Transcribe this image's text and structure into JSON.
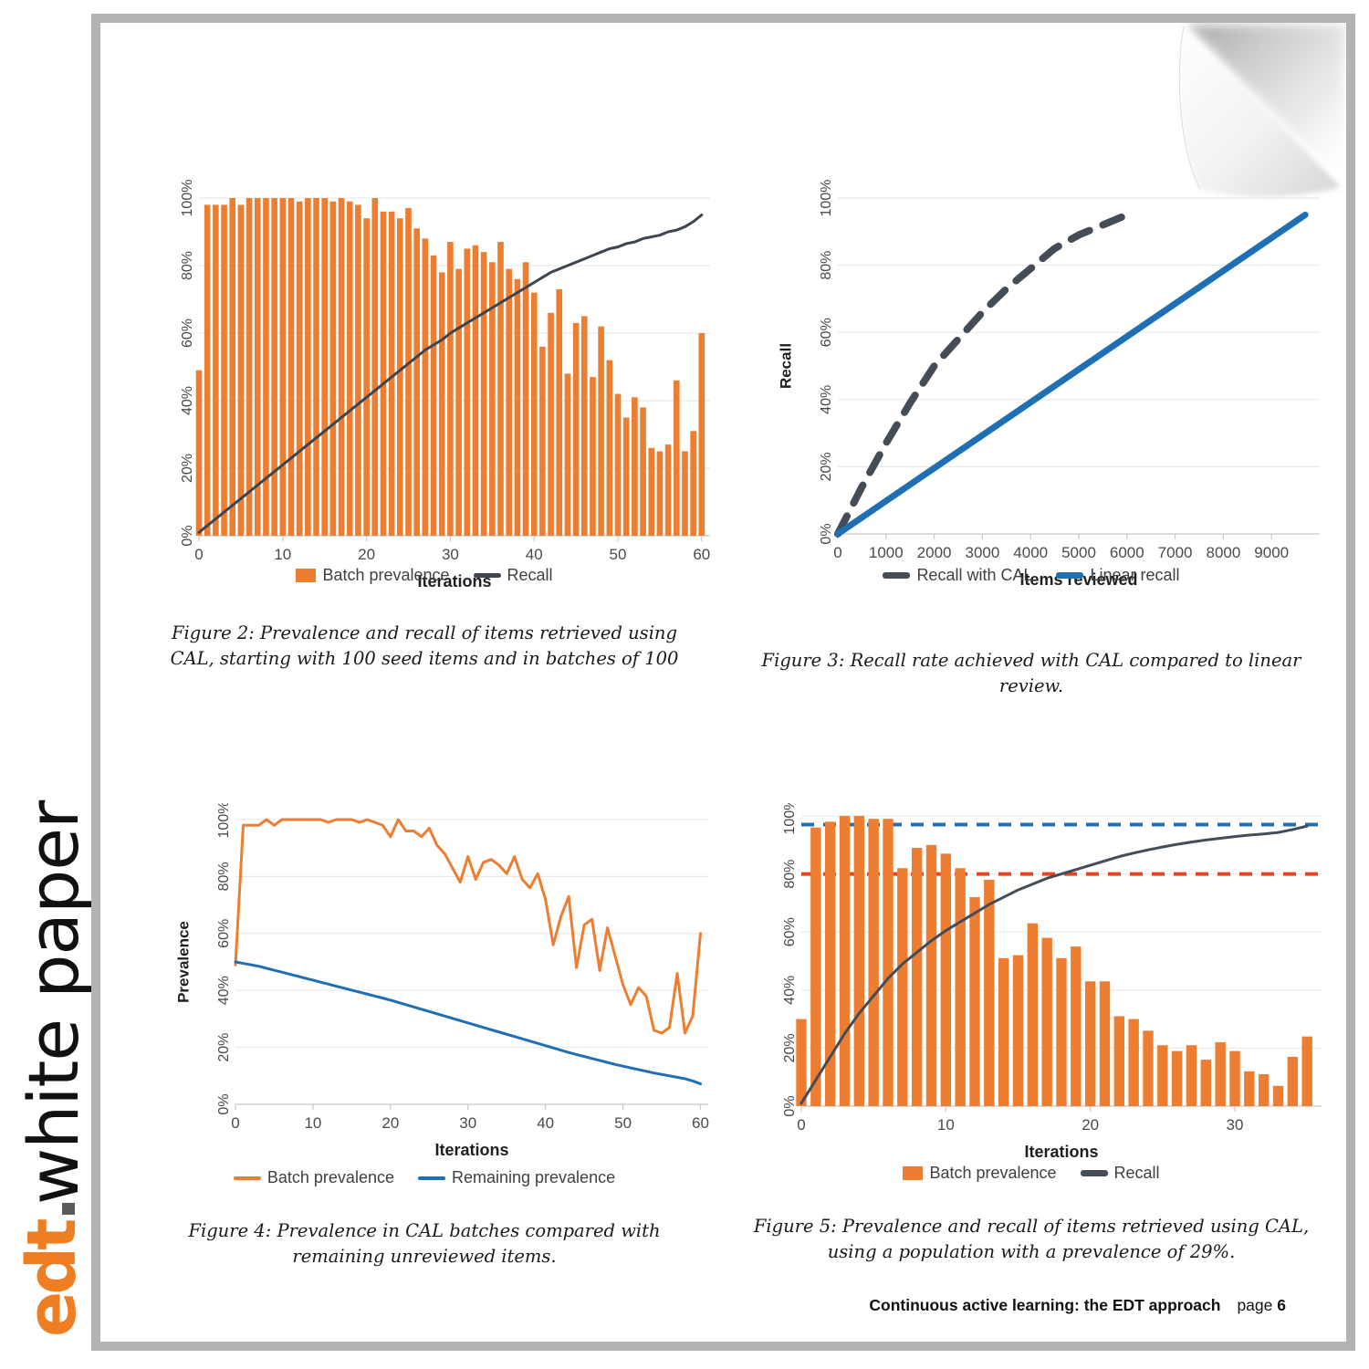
{
  "spine": {
    "logo_text": "edt",
    "logo_dot": ".",
    "label": "white paper"
  },
  "footer": {
    "title": "Continuous active learning: the EDT approach",
    "page_word": "page",
    "page_number": "6"
  },
  "figures": [
    {
      "id": "figure-2",
      "caption": "Figure 2: Prevalence and recall of items retrieved using CAL, starting with 100 seed items and in batches of 100",
      "legend": [
        {
          "label": "Batch prevalence",
          "marker": "box",
          "color": "#ed7d31"
        },
        {
          "label": "Recall",
          "marker": "line",
          "color": "#3c4550"
        }
      ]
    },
    {
      "id": "figure-3",
      "caption": "Figure 3: Recall rate achieved with CAL compared to linear review.",
      "legend": [
        {
          "label": "Recall with CAL",
          "marker": "dashed-line",
          "color": "#444d57"
        },
        {
          "label": "Linear recall",
          "marker": "line",
          "color": "#1f6fb4"
        }
      ]
    },
    {
      "id": "figure-4",
      "caption": "Figure 4: Prevalence in CAL batches compared with remaining unreviewed items.",
      "legend": [
        {
          "label": "Batch prevalence",
          "marker": "line",
          "color": "#ed7d31"
        },
        {
          "label": "Remaining prevalence",
          "marker": "line",
          "color": "#1f6fb4"
        }
      ]
    },
    {
      "id": "figure-5",
      "caption": "Figure 5: Prevalence and recall of items retrieved using CAL, using a population with a prevalence of 29%.",
      "legend": [
        {
          "label": "Batch prevalence",
          "marker": "box",
          "color": "#ed7d31"
        },
        {
          "label": "Recall",
          "marker": "line",
          "color": "#444d57"
        }
      ]
    }
  ],
  "chart_data": [
    {
      "id": "figure-2",
      "type": "bar",
      "title": "",
      "xlabel": "Iterations",
      "ylabel": "",
      "xlim": [
        0,
        61
      ],
      "ylim": [
        0,
        1.0
      ],
      "xticks": [
        0,
        10,
        20,
        30,
        40,
        50,
        60
      ],
      "yticks": [
        "0%",
        "20%",
        "40%",
        "60%",
        "80%",
        "100%"
      ],
      "grid": true,
      "legend_position": "bottom",
      "categories": [
        0,
        1,
        2,
        3,
        4,
        5,
        6,
        7,
        8,
        9,
        10,
        11,
        12,
        13,
        14,
        15,
        16,
        17,
        18,
        19,
        20,
        21,
        22,
        23,
        24,
        25,
        26,
        27,
        28,
        29,
        30,
        31,
        32,
        33,
        34,
        35,
        36,
        37,
        38,
        39,
        40,
        41,
        42,
        43,
        44,
        45,
        46,
        47,
        48,
        49,
        50,
        51,
        52,
        53,
        54,
        55,
        56,
        57,
        58,
        59,
        60
      ],
      "series": [
        {
          "name": "Batch prevalence",
          "type": "bar",
          "color": "#ed7d31",
          "values": [
            0.49,
            0.98,
            0.98,
            0.98,
            1.0,
            0.98,
            1.0,
            1.0,
            1.0,
            1.0,
            1.0,
            1.0,
            0.99,
            1.0,
            1.0,
            1.0,
            0.99,
            1.0,
            0.99,
            0.98,
            0.94,
            1.0,
            0.96,
            0.96,
            0.94,
            0.97,
            0.91,
            0.88,
            0.83,
            0.78,
            0.87,
            0.79,
            0.85,
            0.86,
            0.84,
            0.81,
            0.87,
            0.79,
            0.76,
            0.81,
            0.72,
            0.56,
            0.66,
            0.73,
            0.48,
            0.63,
            0.65,
            0.47,
            0.62,
            0.52,
            0.42,
            0.35,
            0.41,
            0.38,
            0.26,
            0.25,
            0.27,
            0.46,
            0.25,
            0.31,
            0.6
          ]
        },
        {
          "name": "Recall",
          "type": "line",
          "color": "#3c4550",
          "values": [
            0.01,
            0.03,
            0.05,
            0.07,
            0.09,
            0.11,
            0.13,
            0.15,
            0.17,
            0.19,
            0.21,
            0.23,
            0.25,
            0.27,
            0.29,
            0.31,
            0.33,
            0.35,
            0.37,
            0.39,
            0.41,
            0.43,
            0.45,
            0.47,
            0.49,
            0.51,
            0.53,
            0.55,
            0.565,
            0.58,
            0.6,
            0.615,
            0.63,
            0.645,
            0.66,
            0.675,
            0.69,
            0.705,
            0.72,
            0.735,
            0.75,
            0.765,
            0.78,
            0.79,
            0.8,
            0.81,
            0.82,
            0.83,
            0.84,
            0.85,
            0.855,
            0.865,
            0.87,
            0.88,
            0.885,
            0.89,
            0.9,
            0.905,
            0.915,
            0.93,
            0.95
          ]
        }
      ]
    },
    {
      "id": "figure-3",
      "type": "line",
      "title": "",
      "xlabel": "Items reviewed",
      "ylabel": "Recall",
      "xlim": [
        0,
        10000
      ],
      "ylim": [
        0,
        1.0
      ],
      "xticks": [
        0,
        1000,
        2000,
        3000,
        4000,
        5000,
        6000,
        7000,
        8000,
        9000
      ],
      "yticks": [
        "0%",
        "20%",
        "40%",
        "60%",
        "80%",
        "100%"
      ],
      "grid": true,
      "legend_position": "bottom",
      "series": [
        {
          "name": "Recall with CAL",
          "style": "dashed",
          "color": "#444d57",
          "x": [
            0,
            500,
            1000,
            1500,
            2000,
            2500,
            3000,
            3500,
            4000,
            4500,
            5000,
            5500,
            6000
          ],
          "y": [
            0.0,
            0.14,
            0.27,
            0.39,
            0.5,
            0.58,
            0.66,
            0.73,
            0.79,
            0.85,
            0.89,
            0.92,
            0.95
          ]
        },
        {
          "name": "Linear recall",
          "style": "solid",
          "color": "#1f6fb4",
          "x": [
            0,
            9700
          ],
          "y": [
            0.0,
            0.95
          ]
        }
      ]
    },
    {
      "id": "figure-4",
      "type": "line",
      "title": "",
      "xlabel": "Iterations",
      "ylabel": "Prevalence",
      "xlim": [
        0,
        61
      ],
      "ylim": [
        0,
        1.0
      ],
      "xticks": [
        0,
        10,
        20,
        30,
        40,
        50,
        60
      ],
      "yticks": [
        "0%",
        "20%",
        "40%",
        "60%",
        "80%",
        "100%"
      ],
      "grid": true,
      "legend_position": "bottom",
      "categories": [
        0,
        1,
        2,
        3,
        4,
        5,
        6,
        7,
        8,
        9,
        10,
        11,
        12,
        13,
        14,
        15,
        16,
        17,
        18,
        19,
        20,
        21,
        22,
        23,
        24,
        25,
        26,
        27,
        28,
        29,
        30,
        31,
        32,
        33,
        34,
        35,
        36,
        37,
        38,
        39,
        40,
        41,
        42,
        43,
        44,
        45,
        46,
        47,
        48,
        49,
        50,
        51,
        52,
        53,
        54,
        55,
        56,
        57,
        58,
        59,
        60
      ],
      "series": [
        {
          "name": "Batch prevalence",
          "color": "#ed7d31",
          "values": [
            0.49,
            0.98,
            0.98,
            0.98,
            1.0,
            0.98,
            1.0,
            1.0,
            1.0,
            1.0,
            1.0,
            1.0,
            0.99,
            1.0,
            1.0,
            1.0,
            0.99,
            1.0,
            0.99,
            0.98,
            0.94,
            1.0,
            0.96,
            0.96,
            0.94,
            0.97,
            0.91,
            0.88,
            0.83,
            0.78,
            0.87,
            0.79,
            0.85,
            0.86,
            0.84,
            0.81,
            0.87,
            0.79,
            0.76,
            0.81,
            0.72,
            0.56,
            0.66,
            0.73,
            0.48,
            0.63,
            0.65,
            0.47,
            0.62,
            0.52,
            0.42,
            0.35,
            0.41,
            0.38,
            0.26,
            0.25,
            0.27,
            0.46,
            0.25,
            0.31,
            0.6
          ]
        },
        {
          "name": "Remaining prevalence",
          "color": "#1f6fb4",
          "values": [
            0.5,
            0.495,
            0.49,
            0.485,
            0.478,
            0.471,
            0.464,
            0.457,
            0.45,
            0.443,
            0.436,
            0.429,
            0.422,
            0.415,
            0.408,
            0.401,
            0.394,
            0.387,
            0.38,
            0.373,
            0.366,
            0.358,
            0.35,
            0.342,
            0.334,
            0.326,
            0.318,
            0.31,
            0.302,
            0.294,
            0.286,
            0.278,
            0.27,
            0.262,
            0.254,
            0.246,
            0.238,
            0.23,
            0.222,
            0.214,
            0.206,
            0.198,
            0.19,
            0.182,
            0.175,
            0.168,
            0.161,
            0.154,
            0.147,
            0.14,
            0.134,
            0.128,
            0.122,
            0.116,
            0.11,
            0.105,
            0.1,
            0.095,
            0.09,
            0.082,
            0.072
          ]
        }
      ]
    },
    {
      "id": "figure-5",
      "type": "bar",
      "title": "",
      "xlabel": "Iterations",
      "ylabel": "",
      "xlim": [
        0,
        36
      ],
      "ylim": [
        0,
        1.0
      ],
      "xticks": [
        0,
        10,
        20,
        30
      ],
      "yticks": [
        "0%",
        "20%",
        "40%",
        "60%",
        "80%",
        "100%"
      ],
      "grid": true,
      "legend_position": "bottom",
      "reference_lines": [
        {
          "name": "target-prevalence",
          "value": 0.97,
          "color": "#1f6fb4",
          "style": "dashed"
        },
        {
          "name": "target-recall",
          "value": 0.8,
          "color": "#e8441f",
          "style": "dashed"
        }
      ],
      "categories": [
        0,
        1,
        2,
        3,
        4,
        5,
        6,
        7,
        8,
        9,
        10,
        11,
        12,
        13,
        14,
        15,
        16,
        17,
        18,
        19,
        20,
        21,
        22,
        23,
        24,
        25,
        26,
        27,
        28,
        29,
        30,
        31,
        32,
        33,
        34,
        35
      ],
      "series": [
        {
          "name": "Batch prevalence",
          "type": "bar",
          "color": "#ed7d31",
          "values": [
            0.3,
            0.96,
            0.98,
            1.0,
            1.01,
            0.99,
            0.99,
            0.82,
            0.89,
            0.9,
            0.87,
            0.82,
            0.72,
            0.78,
            0.51,
            0.52,
            0.63,
            0.58,
            0.51,
            0.55,
            0.43,
            0.43,
            0.31,
            0.3,
            0.26,
            0.21,
            0.19,
            0.21,
            0.16,
            0.22,
            0.19,
            0.12,
            0.11,
            0.07,
            0.17,
            0.24
          ]
        },
        {
          "name": "Recall",
          "type": "line",
          "color": "#444d57",
          "values": [
            0.01,
            0.09,
            0.17,
            0.25,
            0.32,
            0.38,
            0.44,
            0.49,
            0.53,
            0.57,
            0.605,
            0.635,
            0.665,
            0.695,
            0.72,
            0.745,
            0.765,
            0.785,
            0.8,
            0.815,
            0.83,
            0.845,
            0.86,
            0.872,
            0.883,
            0.893,
            0.902,
            0.91,
            0.917,
            0.923,
            0.929,
            0.934,
            0.938,
            0.943,
            0.953,
            0.965
          ]
        }
      ]
    }
  ]
}
